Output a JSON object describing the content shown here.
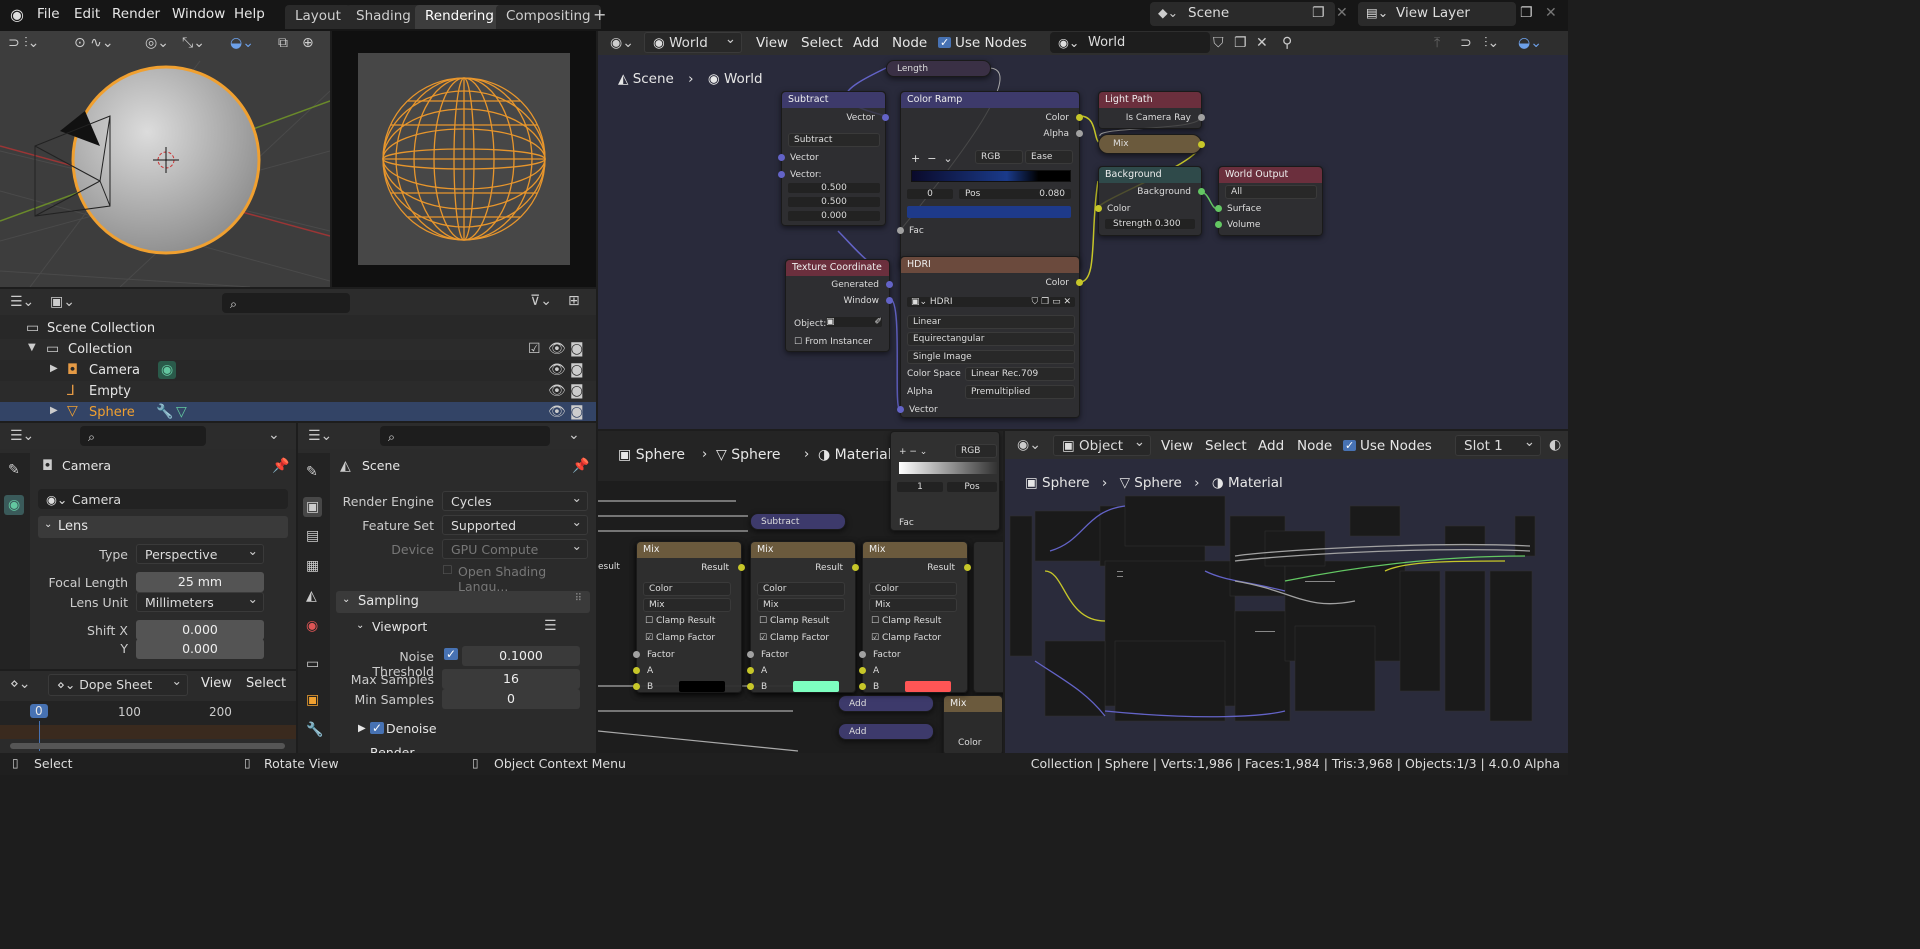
{
  "topbar": {
    "menus": [
      "File",
      "Edit",
      "Render",
      "Window",
      "Help"
    ],
    "workspaces": [
      "Layout",
      "Shading",
      "Rendering",
      "Compositing"
    ],
    "active_workspace": "Rendering",
    "scene": "Scene",
    "view_layer": "View Layer"
  },
  "world_editor": {
    "menus": [
      "View",
      "Select",
      "Add",
      "Node"
    ],
    "world_type": "World",
    "use_nodes_label": "Use Nodes",
    "world_name": "World",
    "breadcrumb": [
      "Scene",
      "World"
    ]
  },
  "nodes": {
    "length": "Length",
    "subtract": {
      "title": "Subtract",
      "vector_out": "Vector",
      "mode": "Subtract",
      "in1": "Vector",
      "in2": "Vector:",
      "v1": "0.500",
      "v2": "0.500",
      "v3": "0.000"
    },
    "color_ramp": {
      "title": "Color Ramp",
      "out_color": "Color",
      "out_alpha": "Alpha",
      "mode": "RGB",
      "interp": "Ease",
      "index": "0",
      "pos_label": "Pos",
      "pos": "0.080",
      "fac": "Fac"
    },
    "light_path": {
      "title": "Light Path",
      "is_camera_ray": "Is Camera Ray"
    },
    "mix": "Mix",
    "background": {
      "title": "Background",
      "out": "Background",
      "color": "Color",
      "strength_label": "Strength",
      "strength": "0.300"
    },
    "world_output": {
      "title": "World Output",
      "target": "All",
      "surface": "Surface",
      "volume": "Volume"
    },
    "texcoord": {
      "title": "Texture Coordinate",
      "generated": "Generated",
      "window": "Window",
      "object_label": "Object:",
      "from_instancer": "From Instancer"
    },
    "hdri": {
      "title": "HDRI",
      "color_out": "Color",
      "image": "HDRI",
      "interp": "Linear",
      "projection": "Equirectangular",
      "source": "Single Image",
      "color_space_label": "Color Space",
      "color_space": "Linear Rec.709",
      "alpha_label": "Alpha",
      "alpha": "Premultiplied",
      "vector": "Vector"
    }
  },
  "outliner": {
    "items": [
      {
        "label": "Scene Collection"
      },
      {
        "label": "Collection"
      },
      {
        "label": "Camera"
      },
      {
        "label": "Empty"
      },
      {
        "label": "Sphere"
      }
    ]
  },
  "properties_left": {
    "object_name": "Camera",
    "data_name": "Camera",
    "section": "Lens",
    "type_label": "Type",
    "type": "Perspective",
    "focal_label": "Focal Length",
    "focal": "25 mm",
    "unit_label": "Lens Unit",
    "unit": "Millimeters",
    "shiftx_label": "Shift X",
    "shiftx": "0.000",
    "shifty_label": "Y",
    "shifty": "0.000"
  },
  "properties_right": {
    "scene": "Scene",
    "engine_label": "Render Engine",
    "engine": "Cycles",
    "feature_label": "Feature Set",
    "feature": "Supported",
    "device_label": "Device",
    "device": "GPU Compute",
    "osl": "Open Shading Langu...",
    "sampling": "Sampling",
    "viewport": "Viewport",
    "noise_label": "Noise Threshold",
    "noise": "0.1000",
    "max_label": "Max Samples",
    "max": "16",
    "min_label": "Min Samples",
    "min": "0",
    "denoise": "Denoise",
    "render": "Render"
  },
  "dopesheet": {
    "mode": "Dope Sheet",
    "menus": [
      "View",
      "Select"
    ],
    "frames": [
      "0",
      "100",
      "200"
    ]
  },
  "material_editor": {
    "type": "Object",
    "menus": [
      "View",
      "Select",
      "Add",
      "Node"
    ],
    "use_nodes": "Use Nodes",
    "slot": "Slot 1",
    "breadcrumb": [
      "Sphere",
      "Sphere",
      "Material"
    ],
    "mid_breadcrumb": [
      "Sphere",
      "Sphere",
      "Material"
    ]
  },
  "mid_nodes": {
    "subtract": "Subtract",
    "mix_title": "Mix",
    "result": "Result",
    "color": "Color",
    "mix": "Mix",
    "clamp_result": "Clamp Result",
    "clamp_factor": "Clamp Factor",
    "factor": "Factor",
    "a": "A",
    "b": "B",
    "add": "Add",
    "rgb": "RGB",
    "one": "1",
    "pos": "Pos",
    "fac": "Fac",
    "esult": "esult"
  },
  "status": {
    "select": "Select",
    "rotate": "Rotate View",
    "context": "Object Context Menu",
    "stats": "Collection | Sphere | Verts:1,986 | Faces:1,984 | Tris:3,968 | Objects:1/3 | 4.0.0 Alpha"
  },
  "colors": {
    "accent": "#4772b3",
    "selected_orange": "#f0a030",
    "node_yellow": "#c7c729",
    "node_blue": "#6363c7",
    "node_green": "#63c763"
  }
}
